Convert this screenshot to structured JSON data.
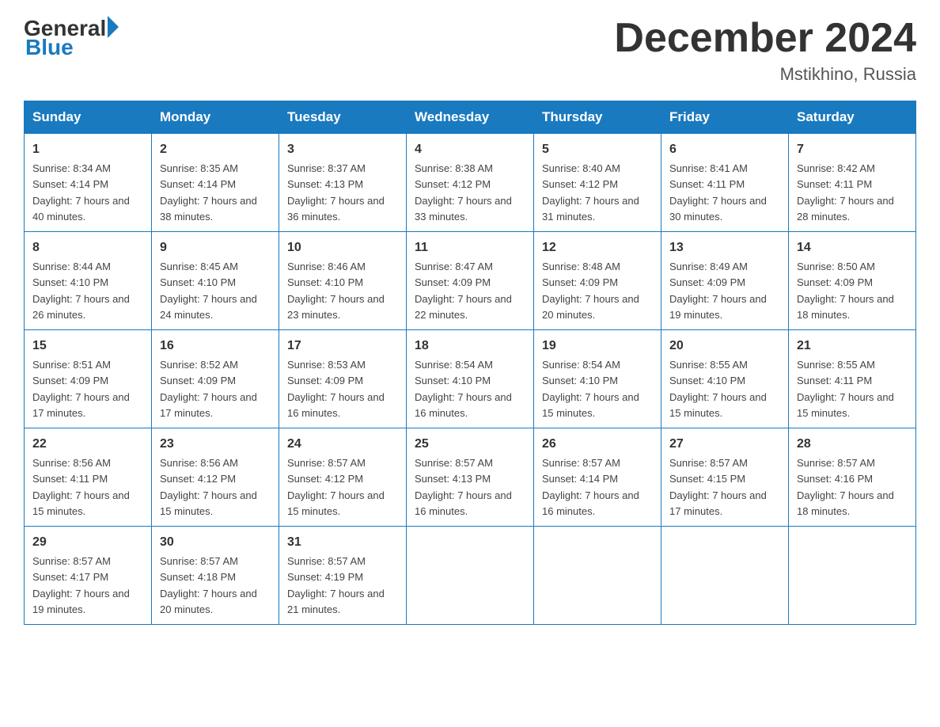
{
  "logo": {
    "general": "General",
    "blue": "Blue"
  },
  "header": {
    "month": "December 2024",
    "location": "Mstikhino, Russia"
  },
  "weekdays": [
    "Sunday",
    "Monday",
    "Tuesday",
    "Wednesday",
    "Thursday",
    "Friday",
    "Saturday"
  ],
  "weeks": [
    [
      {
        "day": "1",
        "sunrise": "8:34 AM",
        "sunset": "4:14 PM",
        "daylight": "7 hours and 40 minutes."
      },
      {
        "day": "2",
        "sunrise": "8:35 AM",
        "sunset": "4:14 PM",
        "daylight": "7 hours and 38 minutes."
      },
      {
        "day": "3",
        "sunrise": "8:37 AM",
        "sunset": "4:13 PM",
        "daylight": "7 hours and 36 minutes."
      },
      {
        "day": "4",
        "sunrise": "8:38 AM",
        "sunset": "4:12 PM",
        "daylight": "7 hours and 33 minutes."
      },
      {
        "day": "5",
        "sunrise": "8:40 AM",
        "sunset": "4:12 PM",
        "daylight": "7 hours and 31 minutes."
      },
      {
        "day": "6",
        "sunrise": "8:41 AM",
        "sunset": "4:11 PM",
        "daylight": "7 hours and 30 minutes."
      },
      {
        "day": "7",
        "sunrise": "8:42 AM",
        "sunset": "4:11 PM",
        "daylight": "7 hours and 28 minutes."
      }
    ],
    [
      {
        "day": "8",
        "sunrise": "8:44 AM",
        "sunset": "4:10 PM",
        "daylight": "7 hours and 26 minutes."
      },
      {
        "day": "9",
        "sunrise": "8:45 AM",
        "sunset": "4:10 PM",
        "daylight": "7 hours and 24 minutes."
      },
      {
        "day": "10",
        "sunrise": "8:46 AM",
        "sunset": "4:10 PM",
        "daylight": "7 hours and 23 minutes."
      },
      {
        "day": "11",
        "sunrise": "8:47 AM",
        "sunset": "4:09 PM",
        "daylight": "7 hours and 22 minutes."
      },
      {
        "day": "12",
        "sunrise": "8:48 AM",
        "sunset": "4:09 PM",
        "daylight": "7 hours and 20 minutes."
      },
      {
        "day": "13",
        "sunrise": "8:49 AM",
        "sunset": "4:09 PM",
        "daylight": "7 hours and 19 minutes."
      },
      {
        "day": "14",
        "sunrise": "8:50 AM",
        "sunset": "4:09 PM",
        "daylight": "7 hours and 18 minutes."
      }
    ],
    [
      {
        "day": "15",
        "sunrise": "8:51 AM",
        "sunset": "4:09 PM",
        "daylight": "7 hours and 17 minutes."
      },
      {
        "day": "16",
        "sunrise": "8:52 AM",
        "sunset": "4:09 PM",
        "daylight": "7 hours and 17 minutes."
      },
      {
        "day": "17",
        "sunrise": "8:53 AM",
        "sunset": "4:09 PM",
        "daylight": "7 hours and 16 minutes."
      },
      {
        "day": "18",
        "sunrise": "8:54 AM",
        "sunset": "4:10 PM",
        "daylight": "7 hours and 16 minutes."
      },
      {
        "day": "19",
        "sunrise": "8:54 AM",
        "sunset": "4:10 PM",
        "daylight": "7 hours and 15 minutes."
      },
      {
        "day": "20",
        "sunrise": "8:55 AM",
        "sunset": "4:10 PM",
        "daylight": "7 hours and 15 minutes."
      },
      {
        "day": "21",
        "sunrise": "8:55 AM",
        "sunset": "4:11 PM",
        "daylight": "7 hours and 15 minutes."
      }
    ],
    [
      {
        "day": "22",
        "sunrise": "8:56 AM",
        "sunset": "4:11 PM",
        "daylight": "7 hours and 15 minutes."
      },
      {
        "day": "23",
        "sunrise": "8:56 AM",
        "sunset": "4:12 PM",
        "daylight": "7 hours and 15 minutes."
      },
      {
        "day": "24",
        "sunrise": "8:57 AM",
        "sunset": "4:12 PM",
        "daylight": "7 hours and 15 minutes."
      },
      {
        "day": "25",
        "sunrise": "8:57 AM",
        "sunset": "4:13 PM",
        "daylight": "7 hours and 16 minutes."
      },
      {
        "day": "26",
        "sunrise": "8:57 AM",
        "sunset": "4:14 PM",
        "daylight": "7 hours and 16 minutes."
      },
      {
        "day": "27",
        "sunrise": "8:57 AM",
        "sunset": "4:15 PM",
        "daylight": "7 hours and 17 minutes."
      },
      {
        "day": "28",
        "sunrise": "8:57 AM",
        "sunset": "4:16 PM",
        "daylight": "7 hours and 18 minutes."
      }
    ],
    [
      {
        "day": "29",
        "sunrise": "8:57 AM",
        "sunset": "4:17 PM",
        "daylight": "7 hours and 19 minutes."
      },
      {
        "day": "30",
        "sunrise": "8:57 AM",
        "sunset": "4:18 PM",
        "daylight": "7 hours and 20 minutes."
      },
      {
        "day": "31",
        "sunrise": "8:57 AM",
        "sunset": "4:19 PM",
        "daylight": "7 hours and 21 minutes."
      },
      null,
      null,
      null,
      null
    ]
  ]
}
